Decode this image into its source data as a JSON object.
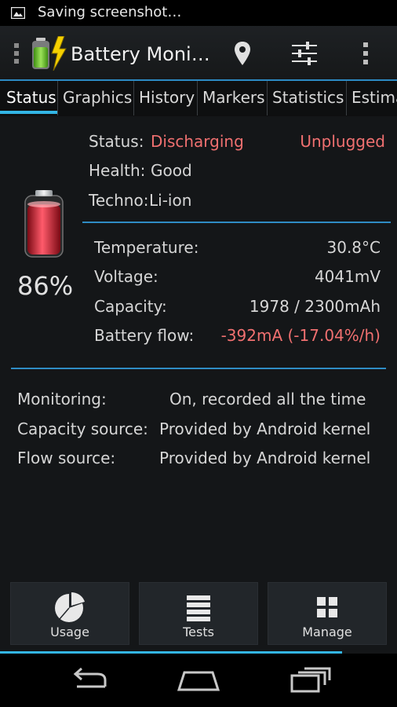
{
  "status_bar": {
    "notification": "Saving screenshot…",
    "icon": "image-icon"
  },
  "action_bar": {
    "title": "Battery Moni…",
    "icons": [
      "overflow-icon",
      "battery-app-icon",
      "location-pin-icon",
      "sliders-icon",
      "more-vert-icon"
    ]
  },
  "tabs": [
    {
      "label": "Status",
      "active": true
    },
    {
      "label": "Graphics"
    },
    {
      "label": "History"
    },
    {
      "label": "Markers"
    },
    {
      "label": "Statistics"
    },
    {
      "label": "Estima"
    }
  ],
  "status": {
    "status_label": "Status:",
    "status_value": "Discharging",
    "plug_state": "Unplugged",
    "health_label": "Health:",
    "health_value": "Good",
    "techno_label": "Techno:",
    "techno_value": "Li-ion",
    "percent": "86%",
    "level": 0.86
  },
  "details": [
    {
      "label": "Temperature:",
      "value": "30.8°C"
    },
    {
      "label": "Voltage:",
      "value": "4041mV"
    },
    {
      "label": "Capacity:",
      "value": "1978 / 2300mAh"
    },
    {
      "label": "Battery flow:",
      "value": "-392mA (-17.04%/h)",
      "highlight": true
    }
  ],
  "sources": [
    {
      "label": "Monitoring:",
      "value": "On, recorded all the time"
    },
    {
      "label": "Capacity source:",
      "value": "Provided by Android kernel"
    },
    {
      "label": "Flow source:",
      "value": "Provided by Android kernel"
    }
  ],
  "bottom_buttons": [
    {
      "label": "Usage",
      "icon": "pie-chart-icon"
    },
    {
      "label": "Tests",
      "icon": "list-icon"
    },
    {
      "label": "Manage",
      "icon": "grid-icon"
    }
  ],
  "navigation": [
    "back-icon",
    "home-icon",
    "recents-icon"
  ],
  "colors": {
    "accent": "#33b5e5",
    "warning": "#f07070",
    "background": "#141618"
  }
}
